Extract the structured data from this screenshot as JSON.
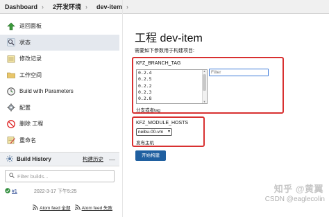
{
  "breadcrumb": [
    "Dashboard",
    "2开发环境",
    "dev-item"
  ],
  "sidebar": {
    "items": [
      {
        "label": "返回面板",
        "icon": "up-arrow-icon"
      },
      {
        "label": "状态",
        "icon": "magnifier-icon"
      },
      {
        "label": "修改记录",
        "icon": "notepad-icon"
      },
      {
        "label": "工作空间",
        "icon": "folder-icon"
      },
      {
        "label": "Build with Parameters",
        "icon": "clock-icon"
      },
      {
        "label": "配置",
        "icon": "gear-icon"
      },
      {
        "label": "删除 工程",
        "icon": "no-entry-icon"
      },
      {
        "label": "重命名",
        "icon": "notepad-pencil-icon"
      }
    ]
  },
  "build_history": {
    "title": "Build History",
    "trend_label": "构建历史",
    "dash": "—",
    "filter_placeholder": "Filter builds...",
    "builds": [
      {
        "number": "#1",
        "date": "2022-3-17 下午5:25",
        "status": "success"
      }
    ],
    "feeds": [
      "Atom feed 全部",
      "Atom feed 失败"
    ]
  },
  "main": {
    "title": "工程 dev-item",
    "description": "需要如下参数用于构建项目:",
    "params": [
      {
        "name": "KFZ_BRANCH_TAG",
        "options": [
          "0.2.4",
          "0.2.5",
          "0.2.2",
          "0.2.3",
          "0.2.8"
        ],
        "filter_placeholder": "Filter",
        "description": "分支或者tag"
      },
      {
        "name": "KFZ_MODULE_HOSTS",
        "selected": "neibu-00-vm",
        "description": "发布主机"
      }
    ],
    "build_button": "开始构建"
  },
  "watermark": {
    "line1": "知乎 @黄翼",
    "line2": "CSDN @eaglecolin"
  },
  "colors": {
    "highlight_border": "#d83030",
    "button_bg": "#1f5fa0",
    "success": "#2e8b3a"
  }
}
